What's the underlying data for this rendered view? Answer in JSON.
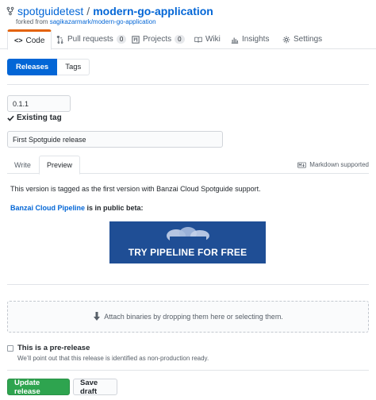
{
  "repo": {
    "owner": "spotguidetest",
    "separator": "/",
    "name": "modern-go-application",
    "forked_prefix": "forked from ",
    "forked_from": "sagikazarmark/modern-go-application"
  },
  "tabs": [
    {
      "label": "Code",
      "icon": "code-icon",
      "counter": null
    },
    {
      "label": "Pull requests",
      "icon": "pull-request-icon",
      "counter": "0"
    },
    {
      "label": "Projects",
      "icon": "project-icon",
      "counter": "0"
    },
    {
      "label": "Wiki",
      "icon": "book-icon",
      "counter": null
    },
    {
      "label": "Insights",
      "icon": "graph-icon",
      "counter": null
    },
    {
      "label": "Settings",
      "icon": "gear-icon",
      "counter": null
    }
  ],
  "subnav": {
    "releases": "Releases",
    "tags": "Tags"
  },
  "release_form": {
    "tag_value": "0.1.1",
    "existing_tag": "Existing tag",
    "title_value": "First Spotguide release",
    "write_tab": "Write",
    "preview_tab": "Preview",
    "markdown_hint": "Markdown supported"
  },
  "preview": {
    "paragraph": "This version is tagged as the first version with Banzai Cloud Spotguide support.",
    "beta_link": "Banzai Cloud Pipeline",
    "beta_suffix": " is in public beta:",
    "banner_bold": "TRY PIPELINE",
    "banner_rest": " FOR FREE"
  },
  "dropzone": {
    "text": "Attach binaries by dropping them here or selecting them."
  },
  "prerelease": {
    "label": "This is a pre-release",
    "note": "We’ll point out that this release is identified as non-production ready."
  },
  "actions": {
    "update": "Update release",
    "draft": "Save draft"
  },
  "colors": {
    "accent": "#0366d6",
    "primary_button": "#2ea44f",
    "active_tab_border": "#e36209",
    "banner": "#1f4e95"
  }
}
